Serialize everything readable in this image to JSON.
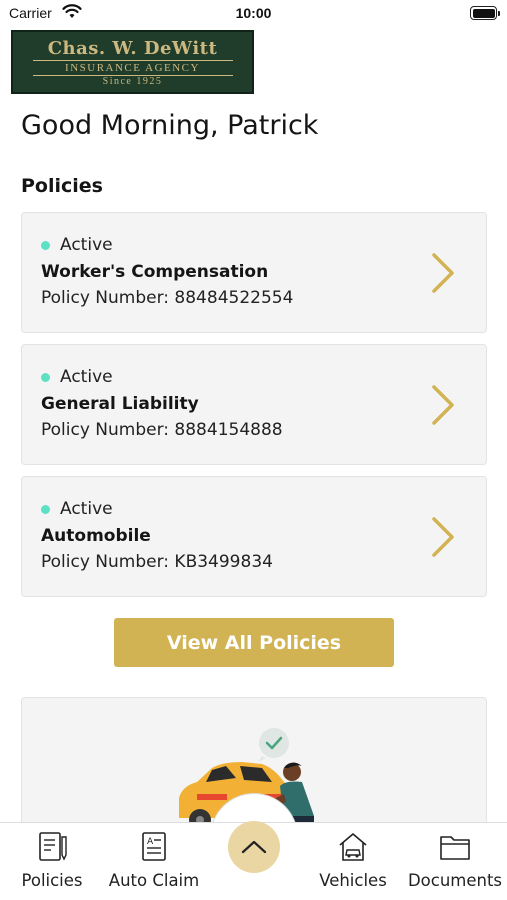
{
  "status_bar": {
    "carrier": "Carrier",
    "time": "10:00"
  },
  "logo": {
    "title": "Chas. W. DeWitt",
    "subtitle": "INSURANCE AGENCY",
    "since": "Since 1925"
  },
  "greeting": "Good Morning, Patrick",
  "policies_section": {
    "title": "Policies",
    "items": [
      {
        "status": "Active",
        "name": "Worker's Compensation",
        "number": "Policy Number: 88484522554"
      },
      {
        "status": "Active",
        "name": "General Liability",
        "number": "Policy Number: 8884154888"
      },
      {
        "status": "Active",
        "name": "Automobile",
        "number": "Policy Number: KB3499834"
      }
    ],
    "view_all_label": "View All Policies"
  },
  "tab_bar": {
    "tabs": [
      {
        "label": "Policies",
        "icon": "policies-icon"
      },
      {
        "label": "Auto Claim",
        "icon": "auto-claim-icon"
      },
      {
        "label": "Vehicles",
        "icon": "vehicles-icon"
      },
      {
        "label": "Documents",
        "icon": "documents-icon"
      }
    ],
    "center_icon": "chevron-up-icon"
  },
  "colors": {
    "accent_gold": "#d2b354",
    "status_active": "#5ee0c4",
    "card_bg": "#f4f4f5",
    "logo_green": "#1f3d2a"
  }
}
